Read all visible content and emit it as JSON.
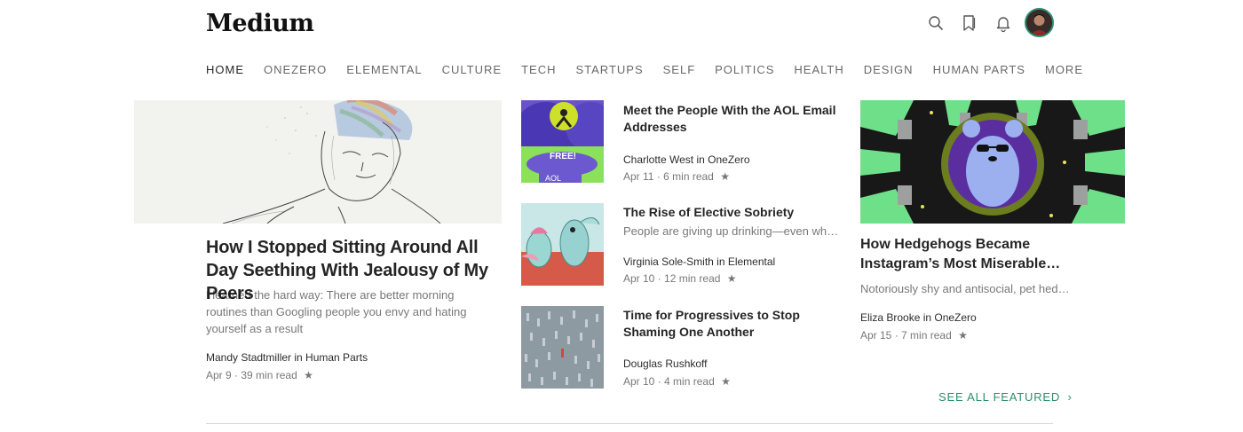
{
  "brand": {
    "logo_text": "Medium",
    "accent_color": "#2b8f6c"
  },
  "header_icons": [
    "search-icon",
    "bookmark-icon",
    "bell-icon",
    "avatar"
  ],
  "nav": [
    "HOME",
    "ONEZERO",
    "ELEMENTAL",
    "CULTURE",
    "TECH",
    "STARTUPS",
    "SELF",
    "POLITICS",
    "HEALTH",
    "DESIGN",
    "HUMAN PARTS",
    "MORE"
  ],
  "main_story": {
    "title": "How I Stopped Sitting Around All Day Seething With Jealousy of My Peers",
    "subtitle": "I learned the hard way: There are better morning routines than Googling people you envy and hating yourself as a result",
    "author": "Mandy Stadtmiller in Human Parts",
    "date": "Apr 9",
    "read_time": "39 min read",
    "star": "★"
  },
  "middle_stories": [
    {
      "title": "Meet the People With the AOL Email Addresses",
      "subtitle": "",
      "author": "Charlotte West in OneZero",
      "date": "Apr 11",
      "read_time": "6 min read",
      "star": "★",
      "thumb_text_1": "FREE!",
      "thumb_text_2": "AOL"
    },
    {
      "title": "The Rise of Elective Sobriety",
      "subtitle": "People are giving up drinking—even when they don't have a problem",
      "author": "Virginia Sole-Smith in Elemental",
      "date": "Apr 10",
      "read_time": "12 min read",
      "star": "★"
    },
    {
      "title": "Time for Progressives to Stop Shaming One Another",
      "subtitle": "",
      "author": "Douglas Rushkoff",
      "date": "Apr 10",
      "read_time": "4 min read",
      "star": "★"
    }
  ],
  "right_story": {
    "title": "How Hedgehogs Became Instagram’s Most Miserable Stars",
    "subtitle": "Notoriously shy and antisocial, pet hedgehogs are being forced into the spotlight",
    "author": "Eliza Brooke in OneZero",
    "date": "Apr 15",
    "read_time": "7 min read",
    "star": "★"
  },
  "see_all": {
    "label": "SEE ALL FEATURED",
    "chevron": "›"
  }
}
